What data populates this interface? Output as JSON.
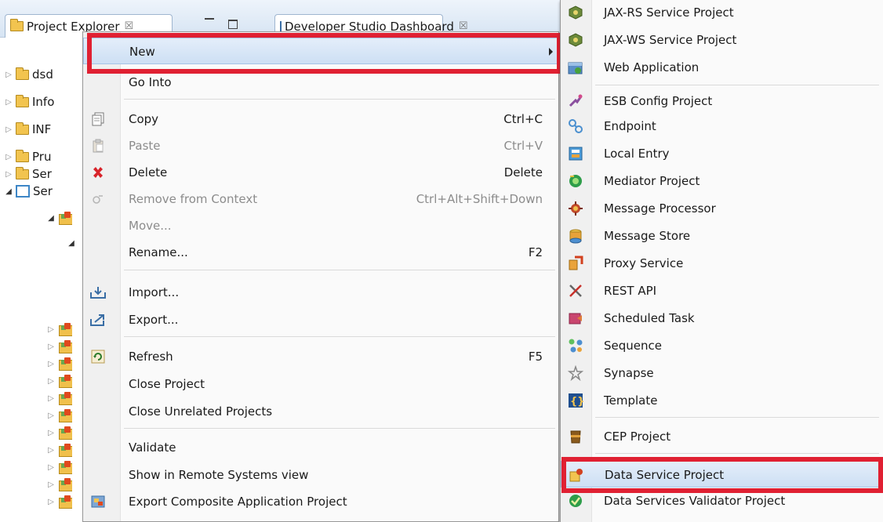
{
  "tabs": {
    "explorer": "Project Explorer",
    "dashboard": "Developer Studio Dashboard",
    "close_glyph": "☒"
  },
  "tree": {
    "items": [
      {
        "label": "dsd",
        "icon": "folder-icon",
        "twisty": "collapsed"
      },
      {
        "label": "Info",
        "icon": "folder-icon",
        "twisty": "collapsed"
      },
      {
        "label": "INF",
        "icon": "folder-icon",
        "twisty": "collapsed"
      },
      {
        "label": "Pru",
        "icon": "folder-icon",
        "twisty": "collapsed"
      },
      {
        "label": "Ser",
        "icon": "open-folder-icon",
        "twisty": "collapsed"
      },
      {
        "label": "Ser",
        "icon": "server-folder-icon",
        "twisty": "expanded"
      }
    ]
  },
  "context_menu": {
    "items": [
      {
        "label": "New",
        "accelerator": "",
        "submenu": true,
        "highlighted": true
      },
      {
        "label": "Go Into",
        "accelerator": ""
      },
      {
        "label": "Copy",
        "accelerator": "Ctrl+C",
        "icon": "copy-icon"
      },
      {
        "label": "Paste",
        "accelerator": "Ctrl+V",
        "icon": "paste-icon",
        "disabled": true
      },
      {
        "label": "Delete",
        "accelerator": "Delete",
        "icon": "delete-icon"
      },
      {
        "label": "Remove from Context",
        "accelerator": "Ctrl+Alt+Shift+Down",
        "icon": "remove-context-icon",
        "disabled": true
      },
      {
        "label": "Move...",
        "accelerator": "",
        "disabled": true
      },
      {
        "label": "Rename...",
        "accelerator": "F2"
      },
      {
        "label": "Import...",
        "accelerator": "",
        "icon": "import-icon"
      },
      {
        "label": "Export...",
        "accelerator": "",
        "icon": "export-icon"
      },
      {
        "label": "Refresh",
        "accelerator": "F5",
        "icon": "refresh-icon"
      },
      {
        "label": "Close Project",
        "accelerator": ""
      },
      {
        "label": "Close Unrelated Projects",
        "accelerator": ""
      },
      {
        "label": "Validate",
        "accelerator": ""
      },
      {
        "label": "Show in Remote Systems view",
        "accelerator": ""
      },
      {
        "label": "Export Composite Application Project",
        "accelerator": "",
        "icon": "composite-export-icon"
      }
    ]
  },
  "new_submenu": {
    "items": [
      {
        "label": "JAX-RS Service Project",
        "icon": "jaxrs-icon"
      },
      {
        "label": "JAX-WS Service Project",
        "icon": "jaxws-icon"
      },
      {
        "label": "Web Application",
        "icon": "web-application-icon"
      },
      {
        "label": "ESB Config Project",
        "icon": "esb-config-icon"
      },
      {
        "label": "Endpoint",
        "icon": "endpoint-icon"
      },
      {
        "label": "Local Entry",
        "icon": "local-entry-icon"
      },
      {
        "label": "Mediator Project",
        "icon": "mediator-icon"
      },
      {
        "label": "Message Processor",
        "icon": "message-processor-icon"
      },
      {
        "label": "Message Store",
        "icon": "message-store-icon"
      },
      {
        "label": "Proxy Service",
        "icon": "proxy-service-icon"
      },
      {
        "label": "REST API",
        "icon": "rest-api-icon"
      },
      {
        "label": "Scheduled Task",
        "icon": "scheduled-task-icon"
      },
      {
        "label": "Sequence",
        "icon": "sequence-icon"
      },
      {
        "label": "Synapse",
        "icon": "synapse-icon"
      },
      {
        "label": "Template",
        "icon": "template-icon"
      },
      {
        "label": "CEP Project",
        "icon": "cep-project-icon"
      },
      {
        "label": "Data Service Project",
        "icon": "data-service-icon",
        "highlighted": true
      },
      {
        "label": "Data Services Validator Project",
        "icon": "data-validator-icon"
      }
    ]
  },
  "colors": {
    "highlight_box": "#e02032",
    "menu_highlight": "#cddff4"
  }
}
